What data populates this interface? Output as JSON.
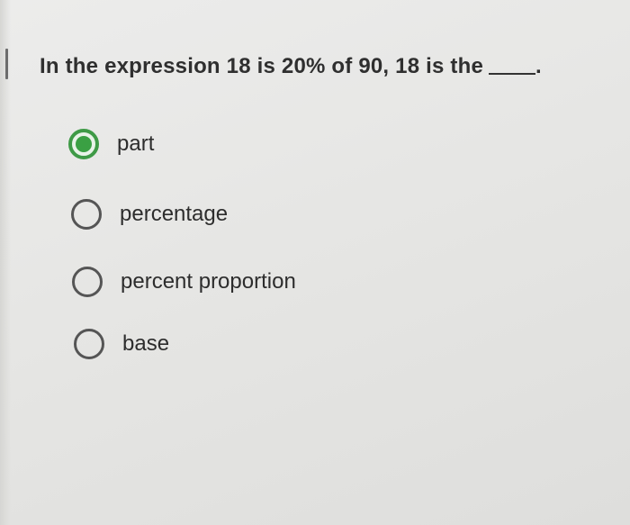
{
  "question": {
    "text": "In the expression 18 is 20% of 90, 18 is the",
    "blank_suffix": "."
  },
  "options": [
    {
      "label": "part",
      "selected": true
    },
    {
      "label": "percentage",
      "selected": false
    },
    {
      "label": "percent proportion",
      "selected": false
    },
    {
      "label": "base",
      "selected": false
    }
  ],
  "colors": {
    "selected_accent": "#3aa043",
    "radio_border": "#555555"
  }
}
